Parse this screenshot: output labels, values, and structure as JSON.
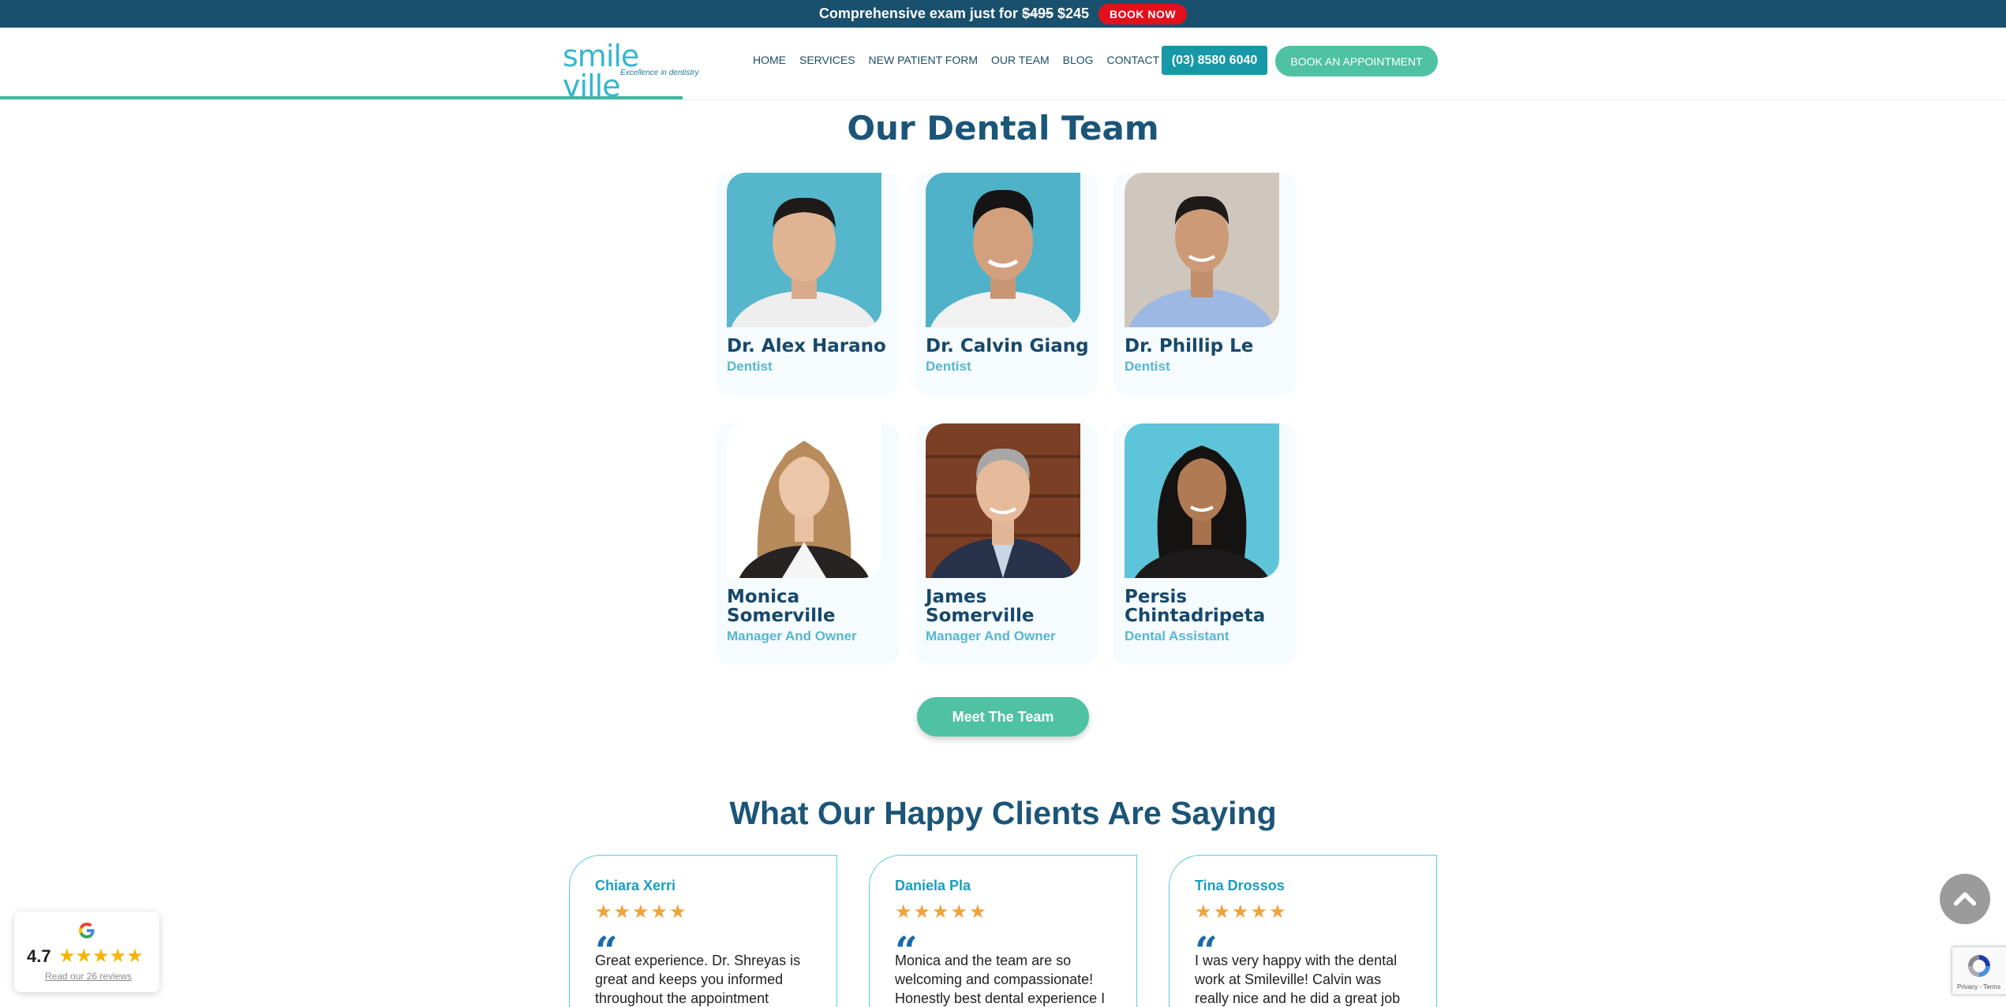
{
  "promo": {
    "text_prefix": "Comprehensive exam just for",
    "old_price": "$495",
    "new_price": "$245",
    "button": "BOOK NOW"
  },
  "header": {
    "logo_text": "smile ville",
    "logo_tagline": "Excellence in dentistry",
    "nav": [
      "HOME",
      "SERVICES",
      "NEW PATIENT FORM",
      "OUR TEAM",
      "BLOG",
      "CONTACT US"
    ],
    "phone": "(03) 8580 6040",
    "book_button": "BOOK AN APPOINTMENT",
    "reading_progress_percent": 34
  },
  "team": {
    "title": "Our Dental Team",
    "members": [
      {
        "name": "Dr. Alex Harano",
        "role": "Dentist"
      },
      {
        "name": "Dr. Calvin Giang",
        "role": "Dentist"
      },
      {
        "name": "Dr. Phillip Le",
        "role": "Dentist"
      },
      {
        "name": "Monica Somerville",
        "role": "Manager And Owner"
      },
      {
        "name": "James Somerville",
        "role": "Manager And Owner"
      },
      {
        "name": "Persis Chintadripeta",
        "role": "Dental Assistant"
      }
    ],
    "button": "Meet The Team"
  },
  "testimonials": {
    "title": "What Our Happy Clients Are Saying",
    "reviews": [
      {
        "name": "Chiara Xerri",
        "stars": "★★★★★",
        "text": "Great experience. Dr. Shreyas is great and keeps you informed throughout the appointment"
      },
      {
        "name": "Daniela Pla",
        "stars": "★★★★★",
        "text": "Monica and the team are so welcoming and compassionate! Honestly best dental experience I"
      },
      {
        "name": "Tina Drossos",
        "stars": "★★★★★",
        "text": "I was very happy with the dental work at Smileville! Calvin was really nice and he did a great job"
      }
    ]
  },
  "google_badge": {
    "rating": "4.7",
    "stars": "★★★★★",
    "link": "Read our 26 reviews"
  },
  "recaptcha": {
    "text": "Privacy - Terms"
  },
  "colors": {
    "navy": "#18506e",
    "teal": "#4ec2a3",
    "accent_blue": "#1698a7",
    "red": "#e3101b"
  }
}
